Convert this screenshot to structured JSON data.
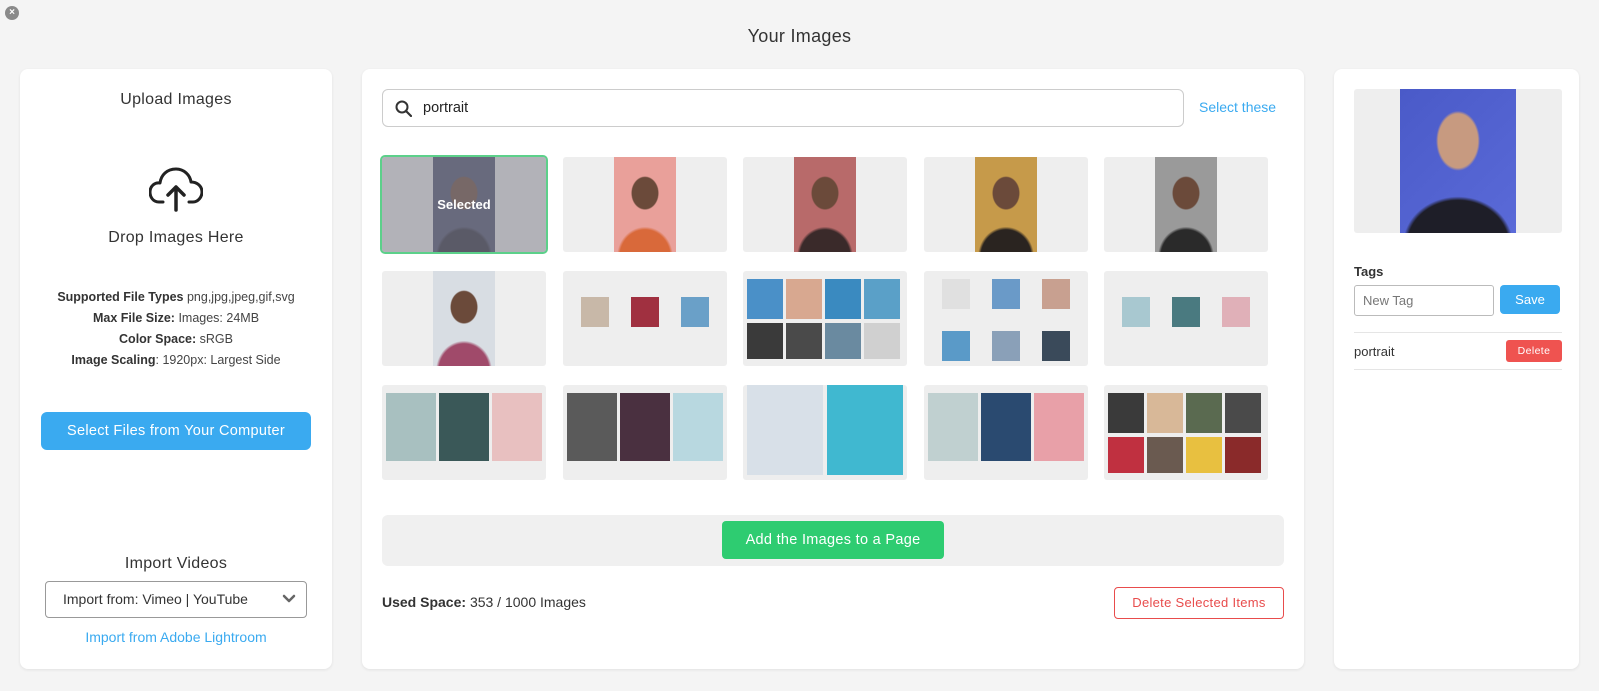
{
  "window": {
    "title": "Your Images",
    "close_glyph": "×"
  },
  "upload": {
    "heading": "Upload Images",
    "icon": "cloud-upload-icon",
    "drop_text": "Drop Images Here",
    "specs": [
      {
        "label": "Supported File Types",
        "value": "png,jpg,jpeg,gif,svg",
        "sep": " "
      },
      {
        "label": "Max File Size:",
        "value": "Images: 24MB",
        "sep": " "
      },
      {
        "label": "Color Space:",
        "value": "sRGB",
        "sep": " "
      },
      {
        "label": "Image Scaling",
        "value": "1920px: Largest Side",
        "sep": ": "
      }
    ],
    "select_button": "Select Files from Your Computer"
  },
  "import": {
    "heading": "Import Videos",
    "select_value": "Import from: Vimeo | YouTube",
    "lightroom_link": "Import from Adobe Lightroom"
  },
  "gallery": {
    "search_value": "portrait",
    "select_these": "Select these",
    "selected_label": "Selected",
    "thumbs": [
      {
        "kind": "portrait",
        "colors": [
          "#4a4e6a",
          "#2b2b3a"
        ],
        "selected": true
      },
      {
        "kind": "portrait",
        "colors": [
          "#e9a09a",
          "#d9693a"
        ]
      },
      {
        "kind": "portrait",
        "colors": [
          "#b86a6a",
          "#3a2a2a"
        ]
      },
      {
        "kind": "portrait",
        "colors": [
          "#c69a4a",
          "#2a2420"
        ]
      },
      {
        "kind": "portrait",
        "colors": [
          "#9a9a9a",
          "#2a2a2a"
        ]
      },
      {
        "kind": "portrait",
        "colors": [
          "#d8dde3",
          "#a04a6a"
        ]
      },
      {
        "kind": "layout3",
        "colors": [
          "#c8b8a8",
          "#a03040",
          "#6aa0c8"
        ]
      },
      {
        "kind": "layout8",
        "colors": [
          "#4a90c8",
          "#d8a890",
          "#3a8ac0",
          "#5aa0c8",
          "#3a3a3a",
          "#4a4a4a",
          "#6a8aa0",
          "#d0d0d0"
        ]
      },
      {
        "kind": "layout6",
        "colors": [
          "#e0e0e0",
          "#6a9ac8",
          "#c8a090",
          "#5a9ac8",
          "#8aa0b8",
          "#3a4a5a"
        ]
      },
      {
        "kind": "layout3",
        "colors": [
          "#a8c8d0",
          "#4a7a80",
          "#e0b0b8"
        ]
      },
      {
        "kind": "layout3big",
        "colors": [
          "#a8c0c0",
          "#3a5858",
          "#e8c0c0"
        ]
      },
      {
        "kind": "layout3big",
        "colors": [
          "#5a5a5a",
          "#4a3040",
          "#b8d8e0"
        ]
      },
      {
        "kind": "layout2",
        "colors": [
          "#d8e0e8",
          "#40b8d0"
        ]
      },
      {
        "kind": "layout3big",
        "colors": [
          "#c0d0d0",
          "#2a4a70",
          "#e8a0a8"
        ]
      },
      {
        "kind": "layout8",
        "colors": [
          "#3a3a3a",
          "#d8b898",
          "#5a6a50",
          "#4a4a4a",
          "#c03040",
          "#6a5a50",
          "#e8c040",
          "#8a2a2a"
        ]
      }
    ],
    "add_button": "Add the Images to a Page",
    "used_space_label": "Used Space:",
    "used_space_value": "353 / 1000 Images",
    "delete_selected": "Delete Selected Items"
  },
  "details": {
    "preview_colors": [
      "#5a6ad8",
      "#1e1e28"
    ],
    "tags_label": "Tags",
    "new_tag_placeholder": "New Tag",
    "save_button": "Save",
    "tags": [
      {
        "name": "portrait",
        "delete_label": "Delete"
      }
    ]
  },
  "colors": {
    "accent_blue": "#3aaaf0",
    "accent_green": "#2ecc71",
    "danger": "#e84c4c"
  }
}
